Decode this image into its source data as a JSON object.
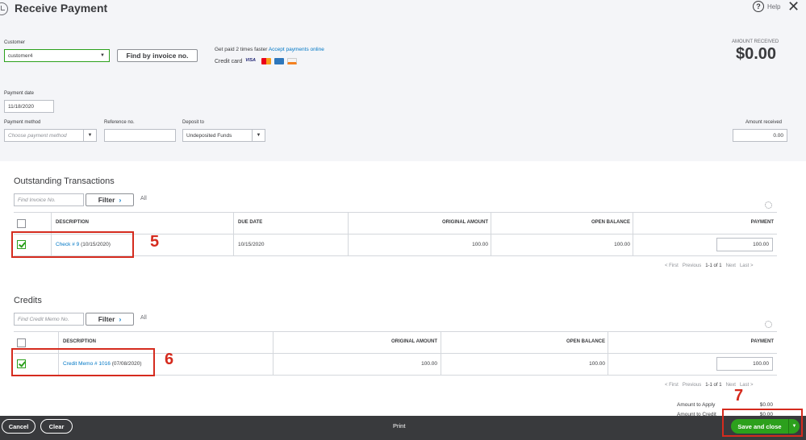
{
  "header": {
    "title": "Receive Payment",
    "help_label": "Help",
    "amount_received_label": "AMOUNT RECEIVED",
    "amount_received_value": "$0.00"
  },
  "form": {
    "customer_label": "Customer",
    "customer_value": "customer4",
    "find_by_invoice_label": "Find by invoice no.",
    "get_paid_text": "Get paid 2 times faster",
    "accept_payments_link": "Accept payments online",
    "credit_card_label": "Credit card",
    "card_icons": [
      "visa-icon",
      "mastercard-icon",
      "amex-icon",
      "discover-icon"
    ],
    "card_visa_text": "VISA",
    "payment_date_label": "Payment date",
    "payment_date_value": "11/18/2020",
    "payment_method_label": "Payment method",
    "payment_method_placeholder": "Choose payment method",
    "reference_label": "Reference no.",
    "reference_value": "",
    "deposit_to_label": "Deposit to",
    "deposit_to_value": "Undeposited Funds",
    "amount_received_field_label": "Amount received",
    "amount_received_field_value": "0.00"
  },
  "outstanding": {
    "title": "Outstanding Transactions",
    "search_placeholder": "Find Invoice No.",
    "filter_label": "Filter",
    "all_label": "All",
    "columns": [
      "DESCRIPTION",
      "DUE DATE",
      "ORIGINAL AMOUNT",
      "OPEN BALANCE",
      "PAYMENT"
    ],
    "rows": [
      {
        "checked": true,
        "link": "Check # 9",
        "date_suffix": " (10/15/2020)",
        "due_date": "10/15/2020",
        "original_amount": "100.00",
        "open_balance": "100.00",
        "payment": "100.00"
      }
    ],
    "pager": {
      "first": "< First",
      "previous": "Previous",
      "range": "1-1 of 1",
      "next": "Next",
      "last": "Last >"
    },
    "annotation": "5"
  },
  "credits": {
    "title": "Credits",
    "search_placeholder": "Find Credit Memo No.",
    "filter_label": "Filter",
    "all_label": "All",
    "columns": [
      "DESCRIPTION",
      "ORIGINAL AMOUNT",
      "OPEN BALANCE",
      "PAYMENT"
    ],
    "rows": [
      {
        "checked": true,
        "link": "Credit Memo # 1016",
        "date_suffix": " (07/08/2020)",
        "original_amount": "100.00",
        "open_balance": "100.00",
        "payment": "100.00"
      }
    ],
    "pager": {
      "first": "< First",
      "previous": "Previous",
      "range": "1-1 of 1",
      "next": "Next",
      "last": "Last >"
    },
    "annotation": "6"
  },
  "totals": {
    "amount_to_apply_label": "Amount to Apply",
    "amount_to_apply_value": "$0.00",
    "amount_to_credit_label": "Amount to Credit",
    "amount_to_credit_value": "$0.00"
  },
  "footer": {
    "cancel_label": "Cancel",
    "clear_label": "Clear",
    "print_label": "Print",
    "save_close_label": "Save and close",
    "annotation": "7"
  },
  "colors": {
    "accent_green": "#2ca01c",
    "link_blue": "#0077c5",
    "annotation_red": "#d52b1e",
    "footer_bg": "#393a3d"
  }
}
